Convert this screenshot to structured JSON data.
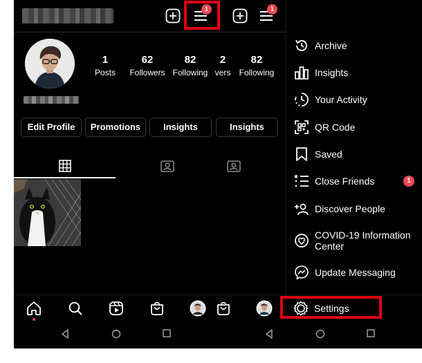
{
  "profile": {
    "stats": [
      {
        "num": "1",
        "label": "Posts"
      },
      {
        "num": "62",
        "label": "Followers"
      },
      {
        "num": "82",
        "label": "Following"
      },
      {
        "num": "2",
        "label": "vers"
      },
      {
        "num": "82",
        "label": "Following"
      }
    ],
    "buttons": {
      "edit_profile": "Edit Profile",
      "promotions": "Promotions",
      "insights": "Insights",
      "insights_2": "Insights"
    },
    "menu_badge_1": "1",
    "menu_badge_2": "1"
  },
  "menu": {
    "items": [
      {
        "label": "Archive",
        "icon": "archive-icon"
      },
      {
        "label": "Insights",
        "icon": "insights-icon"
      },
      {
        "label": "Your Activity",
        "icon": "activity-icon"
      },
      {
        "label": "QR Code",
        "icon": "qr-code-icon"
      },
      {
        "label": "Saved",
        "icon": "bookmark-icon"
      },
      {
        "label": "Close Friends",
        "icon": "close-friends-icon",
        "badge": "1"
      },
      {
        "label": "Discover People",
        "icon": "add-person-icon"
      },
      {
        "label": "COVID-19 Information Center",
        "icon": "covid-info-icon"
      },
      {
        "label": "Update Messaging",
        "icon": "messenger-icon"
      },
      {
        "label": "Settings",
        "icon": "gear-icon"
      }
    ]
  },
  "colors": {
    "background": "#000000",
    "highlight": "#e0000f",
    "badge": "#ed4956",
    "text": "#ffffff"
  }
}
